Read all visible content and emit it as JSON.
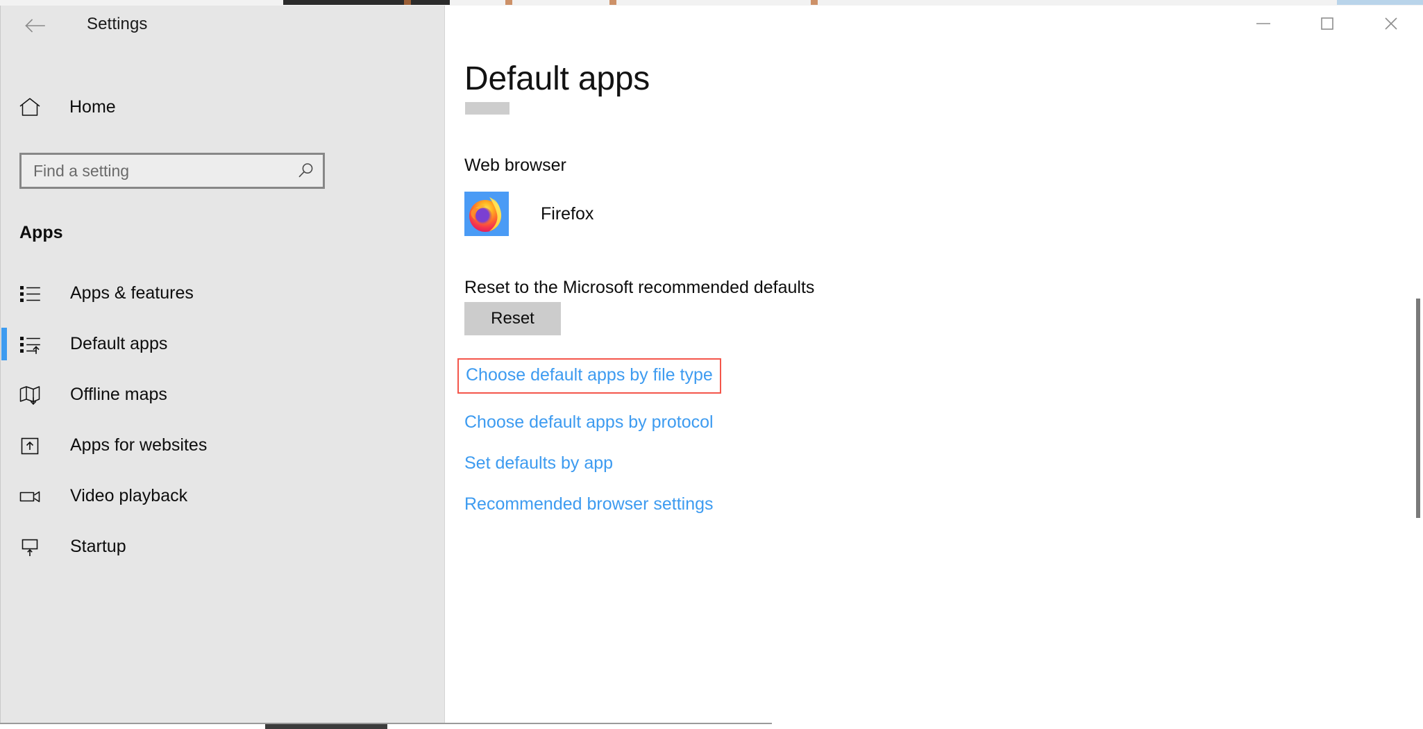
{
  "window": {
    "app_title": "Settings",
    "back_icon": "back-arrow-icon",
    "controls": {
      "minimize": "minimize-icon",
      "maximize": "maximize-icon",
      "close": "close-icon"
    }
  },
  "sidebar": {
    "home": {
      "label": "Home",
      "icon": "home-icon"
    },
    "search": {
      "value": "",
      "placeholder": "Find a setting",
      "icon": "search-icon"
    },
    "section_title": "Apps",
    "items": [
      {
        "label": "Apps & features",
        "icon": "list-bullets-icon",
        "selected": false
      },
      {
        "label": "Default apps",
        "icon": "list-arrow-up-icon",
        "selected": true
      },
      {
        "label": "Offline maps",
        "icon": "map-download-icon",
        "selected": false
      },
      {
        "label": "Apps for websites",
        "icon": "box-arrow-up-icon",
        "selected": false
      },
      {
        "label": "Video playback",
        "icon": "video-camera-icon",
        "selected": false
      },
      {
        "label": "Startup",
        "icon": "monitor-arrow-up-icon",
        "selected": false
      }
    ]
  },
  "main": {
    "page_title": "Default apps",
    "group_label": "Web browser",
    "default_app": {
      "name": "Firefox",
      "icon": "firefox-icon",
      "tile_color": "#4a9bf5"
    },
    "reset": {
      "label": "Reset to the Microsoft recommended defaults",
      "button_label": "Reset"
    },
    "links": [
      {
        "label": "Choose default apps by file type",
        "highlighted": true
      },
      {
        "label": "Choose default apps by protocol",
        "highlighted": false
      },
      {
        "label": "Set defaults by app",
        "highlighted": false
      },
      {
        "label": "Recommended browser settings",
        "highlighted": false
      }
    ]
  },
  "colors": {
    "accent": "#3d9bf0",
    "highlight_outline": "#f4554a",
    "nav_background": "#e6e6e6",
    "link": "#3d9bf0"
  }
}
